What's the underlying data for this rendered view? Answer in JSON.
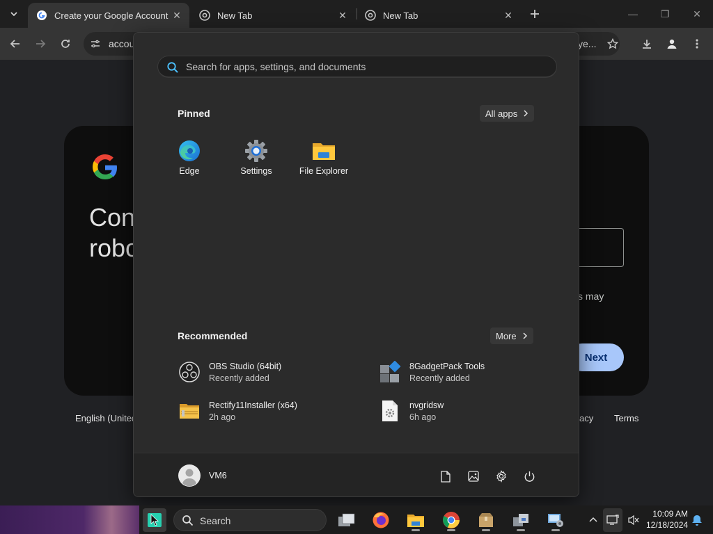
{
  "browser": {
    "tabs": [
      {
        "title": "Create your Google Account",
        "active": true
      },
      {
        "title": "New Tab",
        "active": false
      },
      {
        "title": "New Tab",
        "active": false
      }
    ],
    "address_left": "accou",
    "address_right": "ye..."
  },
  "page": {
    "heading_line1": "Con",
    "heading_line2": "robo",
    "hint_text": "s may",
    "next_label": "Next",
    "language": "English (United",
    "privacy": "acy",
    "terms": "Terms"
  },
  "start_menu": {
    "search_placeholder": "Search for apps, settings, and documents",
    "pinned_title": "Pinned",
    "all_apps_label": "All apps",
    "pinned": [
      {
        "label": "Edge",
        "icon": "edge-icon"
      },
      {
        "label": "Settings",
        "icon": "settings-gear-icon"
      },
      {
        "label": "File Explorer",
        "icon": "folder-icon"
      }
    ],
    "recommended_title": "Recommended",
    "more_label": "More",
    "recommended": [
      {
        "name": "OBS Studio (64bit)",
        "sub": "Recently added",
        "icon": "obs-icon"
      },
      {
        "name": "8GadgetPack Tools",
        "sub": "Recently added",
        "icon": "gadgetpack-icon"
      },
      {
        "name": "Rectify11Installer (x64)",
        "sub": "2h ago",
        "icon": "zip-folder-icon"
      },
      {
        "name": "nvgridsw",
        "sub": "6h ago",
        "icon": "file-gear-icon"
      }
    ],
    "user_name": "VM6"
  },
  "taskbar": {
    "search_label": "Search",
    "time": "10:09 AM",
    "date": "12/18/2024"
  },
  "colors": {
    "start_bg": "#2b2b2b",
    "accent": "#a8c7fa",
    "taskbar_bg": "#1c1c1c"
  }
}
